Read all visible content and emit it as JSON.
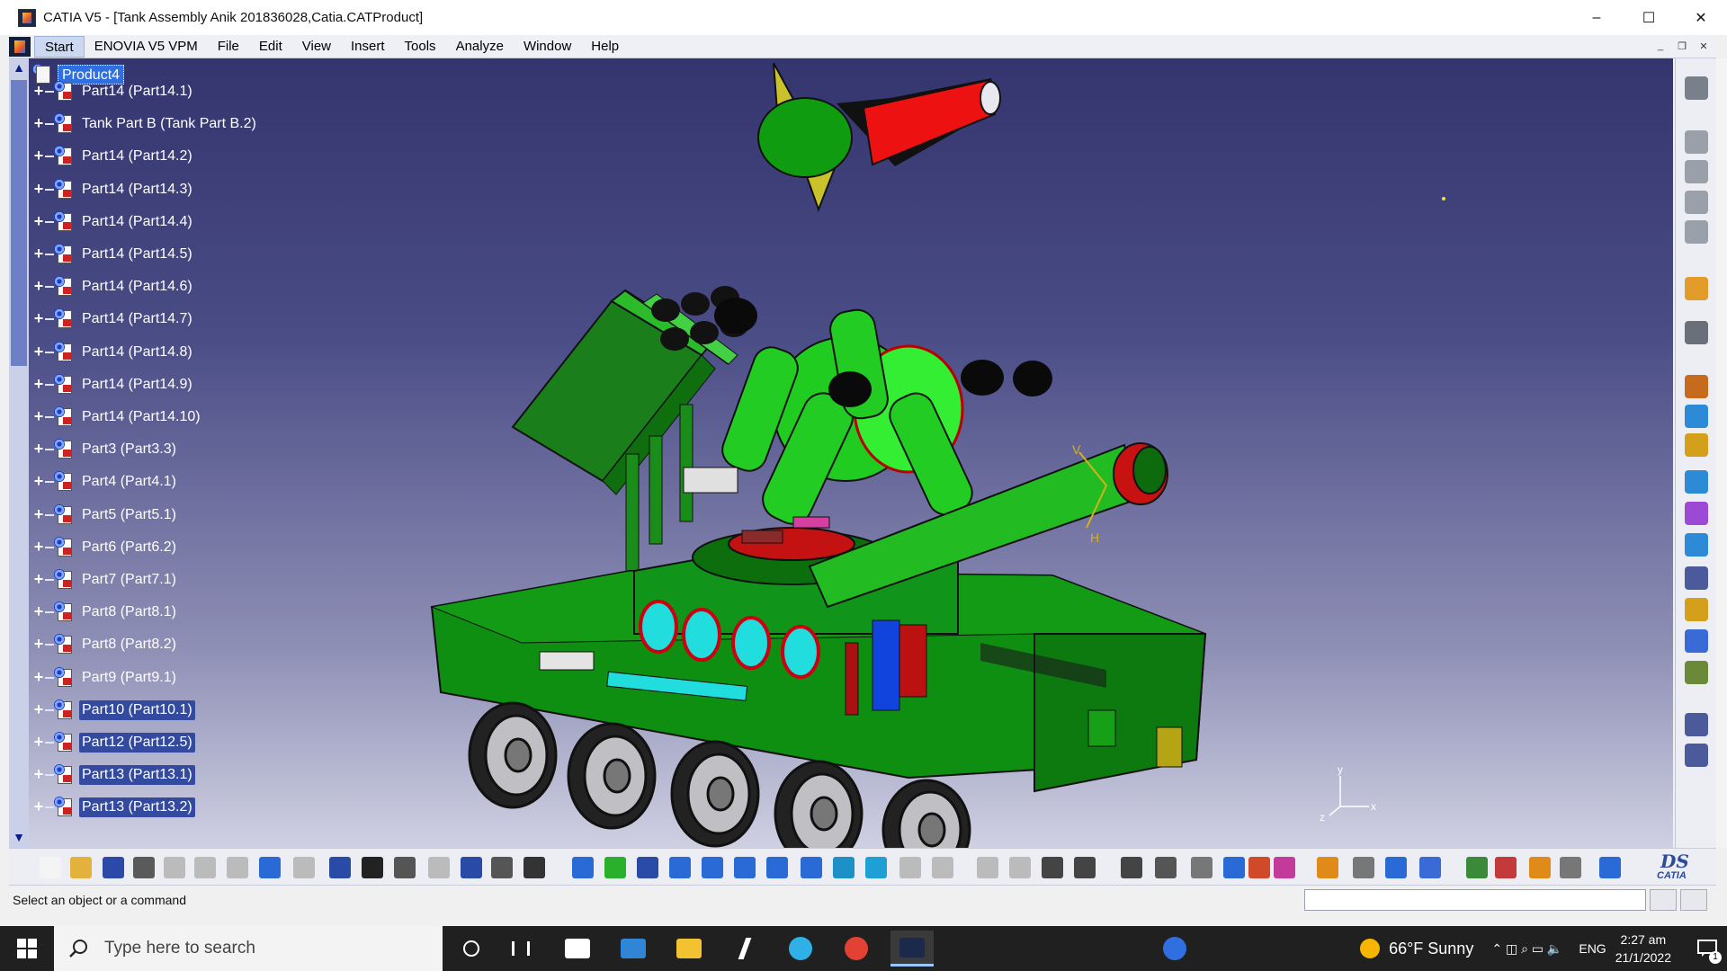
{
  "window": {
    "title": "CATIA V5 - [Tank Assembly Anik 201836028,Catia.CATProduct]",
    "controls": {
      "minimize": "–",
      "maximize": "☐",
      "close": "✕"
    }
  },
  "menubar": {
    "items": [
      "Start",
      "ENOVIA V5 VPM",
      "File",
      "Edit",
      "View",
      "Insert",
      "Tools",
      "Analyze",
      "Window",
      "Help"
    ],
    "mdi": {
      "minimize": "_",
      "restore": "❐",
      "close": "✕"
    }
  },
  "tree": {
    "root": "Product4",
    "items": [
      "Part14 (Part14.1)",
      "Tank Part B (Tank Part B.2)",
      "Part14 (Part14.2)",
      "Part14 (Part14.3)",
      "Part14 (Part14.4)",
      "Part14 (Part14.5)",
      "Part14 (Part14.6)",
      "Part14 (Part14.7)",
      "Part14 (Part14.8)",
      "Part14 (Part14.9)",
      "Part14 (Part14.10)",
      "Part3 (Part3.3)",
      "Part4 (Part4.1)",
      "Part5 (Part5.1)",
      "Part6 (Part6.2)",
      "Part7 (Part7.1)",
      "Part8 (Part8.1)",
      "Part8 (Part8.2)",
      "Part9 (Part9.1)",
      "Part10 (Part10.1)",
      "Part12 (Part12.5)",
      "Part13 (Part13.1)",
      "Part13 (Part13.2)"
    ]
  },
  "viewport": {
    "axis_labels": {
      "v": "V",
      "h": "H"
    },
    "compass": {
      "y": "y",
      "x": "x",
      "z": "z"
    }
  },
  "statusbar": {
    "prompt": "Select an object or a command"
  },
  "logo": {
    "mark": "DS",
    "product": "CATIA"
  },
  "taskbar": {
    "search_placeholder": "Type here to search",
    "weather": "66°F  Sunny",
    "language": "ENG",
    "time": "2:27 am",
    "date": "21/1/2022",
    "notification_count": "1"
  },
  "colors": {
    "vehicle_green": "#0f8f12",
    "turret_green": "#22dd22",
    "missile_red": "#ee1111",
    "window_cyan": "#22dddd",
    "viewport_top": "#34356f",
    "viewport_bottom": "#cfd0e2"
  }
}
